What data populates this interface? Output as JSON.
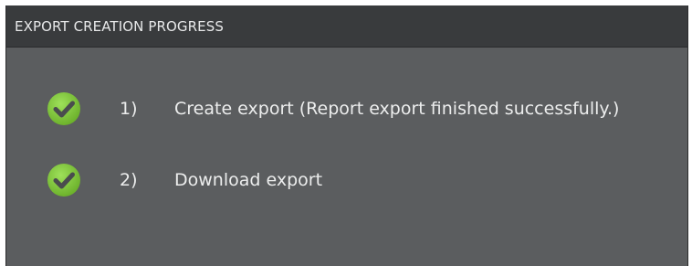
{
  "panel": {
    "title": "EXPORT CREATION PROGRESS"
  },
  "steps": [
    {
      "number": "1)",
      "label": "Create export (Report export finished successfully.)",
      "status_icon": "check-circle-icon",
      "status": "done"
    },
    {
      "number": "2)",
      "label": "Download export",
      "status_icon": "check-circle-icon",
      "status": "done"
    }
  ],
  "colors": {
    "header_bg": "#393b3d",
    "body_bg": "#5b5d5f",
    "success_green": "#7cc13a",
    "text": "#eceded"
  }
}
